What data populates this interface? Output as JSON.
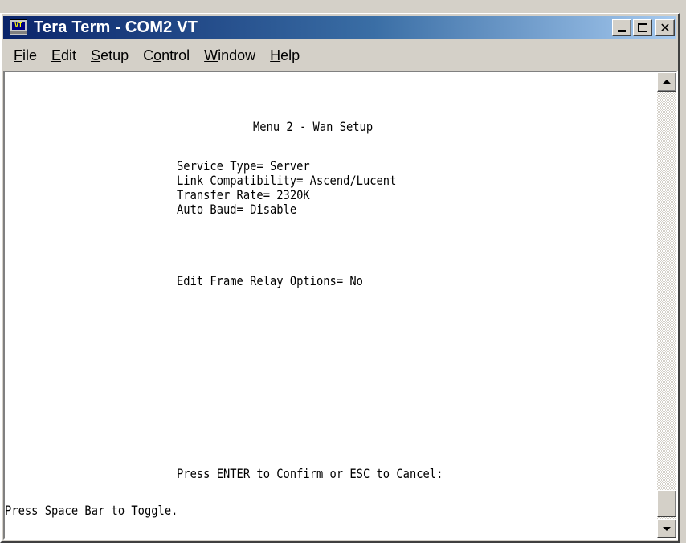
{
  "window": {
    "title": "Tera Term - COM2 VT",
    "app_icon_label": "VT",
    "buttons": {
      "minimize": "minimize",
      "maximize": "maximize",
      "close": "✕"
    }
  },
  "menubar": {
    "items": [
      {
        "first": "F",
        "rest": "ile"
      },
      {
        "first": "E",
        "rest": "dit"
      },
      {
        "first": "S",
        "rest": "etup"
      },
      {
        "pre": "C",
        "first": "o",
        "rest": "ntrol"
      },
      {
        "first": "W",
        "rest": "indow"
      },
      {
        "first": "H",
        "rest": "elp"
      }
    ]
  },
  "terminal": {
    "menu_title": "Menu 2 - Wan Setup",
    "service_type": "Service Type= Server",
    "link_compatibility": "Link Compatibility= Ascend/Lucent",
    "transfer_rate": "Transfer Rate= 2320K",
    "auto_baud": "Auto Baud= Disable",
    "edit_frame_relay": "Edit Frame Relay Options= No",
    "confirm_prompt": "Press ENTER to Confirm or ESC to Cancel:",
    "toggle_hint": "Press Space Bar to Toggle."
  },
  "colors": {
    "titlebar_start": "#0a246a",
    "titlebar_end": "#a6caf0",
    "chrome": "#d4d0c8",
    "terminal_bg": "#ffffff",
    "terminal_fg": "#000000"
  },
  "icons": [
    "terminal-app-icon",
    "minimize-icon",
    "maximize-icon",
    "close-icon",
    "scroll-up-arrow-icon",
    "scroll-down-arrow-icon"
  ]
}
